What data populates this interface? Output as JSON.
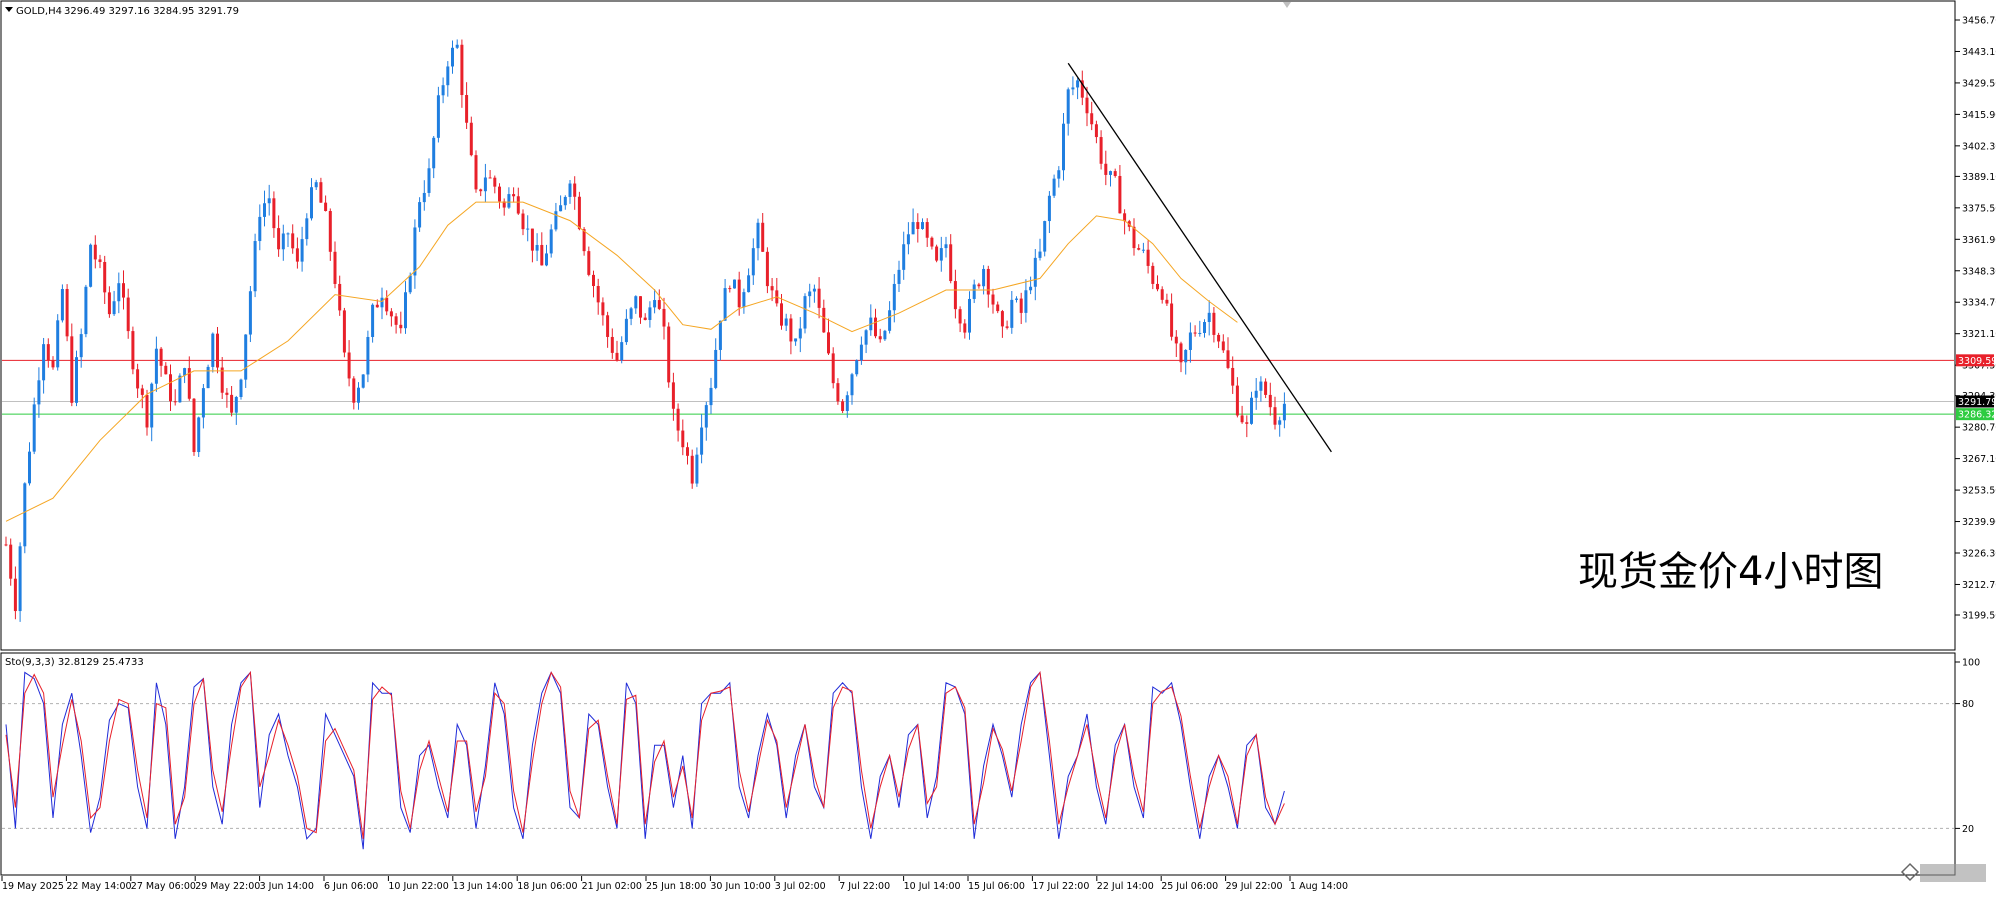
{
  "header": {
    "symbol": "GOLD,H4",
    "ohlc": "3296.49 3297.16 3284.95 3291.79"
  },
  "chart_title_overlay": "现货金价4小时图",
  "chart_data": [
    {
      "type": "candlestick",
      "symbol": "GOLD",
      "timeframe": "H4",
      "ylim": [
        3199.5,
        3456.7
      ],
      "price_axis_ticks": [
        "3456.70",
        "3443.10",
        "3429.50",
        "3415.90",
        "3402.30",
        "3389.10",
        "3375.50",
        "3361.90",
        "3348.30",
        "3334.70",
        "3321.10",
        "3307.50",
        "3294.30",
        "3280.70",
        "3267.10",
        "3253.50",
        "3239.90",
        "3226.30",
        "3212.70",
        "3199.50"
      ],
      "time_axis_ticks": [
        "19 May 2025",
        "22 May 14:00",
        "27 May 06:00",
        "29 May 22:00",
        "3 Jun 14:00",
        "6 Jun 06:00",
        "10 Jun 22:00",
        "13 Jun 14:00",
        "18 Jun 06:00",
        "21 Jun 02:00",
        "25 Jun 18:00",
        "30 Jun 10:00",
        "3 Jul 02:00",
        "7 Jul 22:00",
        "10 Jul 14:00",
        "15 Jul 06:00",
        "17 Jul 22:00",
        "22 Jul 14:00",
        "25 Jul 06:00",
        "29 Jul 22:00",
        "1 Aug 14:00"
      ],
      "horizontal_lines": [
        {
          "price": 3309.59,
          "label": "3309.59",
          "color": "#e8202a"
        },
        {
          "price": 3291.79,
          "label": "3291.79",
          "color": "#c0c0c0"
        },
        {
          "price": 3286.32,
          "label": "3286.32",
          "color": "#2ecc40"
        }
      ],
      "price_path": [
        [
          0,
          3230
        ],
        [
          2,
          3205
        ],
        [
          4,
          3255
        ],
        [
          6,
          3290
        ],
        [
          8,
          3320
        ],
        [
          10,
          3305
        ],
        [
          12,
          3340
        ],
        [
          14,
          3295
        ],
        [
          16,
          3320
        ],
        [
          18,
          3360
        ],
        [
          20,
          3348
        ],
        [
          22,
          3330
        ],
        [
          24,
          3345
        ],
        [
          26,
          3320
        ],
        [
          28,
          3300
        ],
        [
          30,
          3285
        ],
        [
          32,
          3315
        ],
        [
          34,
          3300
        ],
        [
          36,
          3290
        ],
        [
          38,
          3310
        ],
        [
          40,
          3270
        ],
        [
          42,
          3300
        ],
        [
          44,
          3320
        ],
        [
          46,
          3300
        ],
        [
          48,
          3285
        ],
        [
          50,
          3305
        ],
        [
          52,
          3340
        ],
        [
          54,
          3375
        ],
        [
          56,
          3380
        ],
        [
          58,
          3355
        ],
        [
          60,
          3365
        ],
        [
          62,
          3350
        ],
        [
          64,
          3375
        ],
        [
          66,
          3385
        ],
        [
          68,
          3370
        ],
        [
          70,
          3345
        ],
        [
          72,
          3310
        ],
        [
          74,
          3295
        ],
        [
          76,
          3305
        ],
        [
          78,
          3330
        ],
        [
          80,
          3340
        ],
        [
          82,
          3330
        ],
        [
          84,
          3320
        ],
        [
          86,
          3350
        ],
        [
          88,
          3380
        ],
        [
          90,
          3390
        ],
        [
          92,
          3420
        ],
        [
          94,
          3440
        ],
        [
          96,
          3445
        ],
        [
          98,
          3410
        ],
        [
          100,
          3380
        ],
        [
          102,
          3390
        ],
        [
          104,
          3385
        ],
        [
          106,
          3375
        ],
        [
          108,
          3385
        ],
        [
          110,
          3370
        ],
        [
          112,
          3360
        ],
        [
          114,
          3350
        ],
        [
          116,
          3365
        ],
        [
          118,
          3375
        ],
        [
          120,
          3390
        ],
        [
          122,
          3370
        ],
        [
          124,
          3350
        ],
        [
          126,
          3335
        ],
        [
          128,
          3320
        ],
        [
          130,
          3310
        ],
        [
          132,
          3325
        ],
        [
          134,
          3335
        ],
        [
          136,
          3325
        ],
        [
          138,
          3340
        ],
        [
          140,
          3320
        ],
        [
          142,
          3285
        ],
        [
          144,
          3275
        ],
        [
          146,
          3260
        ],
        [
          148,
          3285
        ],
        [
          150,
          3300
        ],
        [
          152,
          3330
        ],
        [
          154,
          3345
        ],
        [
          156,
          3335
        ],
        [
          158,
          3350
        ],
        [
          160,
          3365
        ],
        [
          162,
          3345
        ],
        [
          164,
          3330
        ],
        [
          166,
          3325
        ],
        [
          168,
          3315
        ],
        [
          170,
          3335
        ],
        [
          172,
          3340
        ],
        [
          174,
          3320
        ],
        [
          176,
          3300
        ],
        [
          178,
          3290
        ],
        [
          180,
          3305
        ],
        [
          182,
          3320
        ],
        [
          184,
          3325
        ],
        [
          186,
          3315
        ],
        [
          188,
          3330
        ],
        [
          190,
          3350
        ],
        [
          192,
          3365
        ],
        [
          194,
          3370
        ],
        [
          196,
          3360
        ],
        [
          198,
          3350
        ],
        [
          200,
          3360
        ],
        [
          202,
          3335
        ],
        [
          204,
          3325
        ],
        [
          206,
          3340
        ],
        [
          208,
          3350
        ],
        [
          210,
          3335
        ],
        [
          212,
          3320
        ],
        [
          214,
          3335
        ],
        [
          216,
          3330
        ],
        [
          218,
          3345
        ],
        [
          220,
          3355
        ],
        [
          222,
          3380
        ],
        [
          224,
          3395
        ],
        [
          226,
          3425
        ],
        [
          228,
          3430
        ],
        [
          230,
          3420
        ],
        [
          232,
          3405
        ],
        [
          234,
          3390
        ],
        [
          236,
          3385
        ],
        [
          238,
          3370
        ],
        [
          240,
          3360
        ],
        [
          242,
          3355
        ],
        [
          244,
          3345
        ],
        [
          246,
          3340
        ],
        [
          248,
          3320
        ],
        [
          250,
          3305
        ],
        [
          252,
          3320
        ],
        [
          254,
          3325
        ],
        [
          256,
          3330
        ],
        [
          258,
          3320
        ],
        [
          260,
          3305
        ],
        [
          262,
          3290
        ],
        [
          264,
          3280
        ],
        [
          266,
          3300
        ],
        [
          268,
          3295
        ],
        [
          270,
          3285
        ],
        [
          272,
          3291
        ]
      ],
      "ma_path": [
        [
          0,
          3240
        ],
        [
          10,
          3250
        ],
        [
          20,
          3275
        ],
        [
          30,
          3295
        ],
        [
          40,
          3305
        ],
        [
          50,
          3305
        ],
        [
          60,
          3318
        ],
        [
          70,
          3338
        ],
        [
          80,
          3335
        ],
        [
          88,
          3350
        ],
        [
          94,
          3368
        ],
        [
          100,
          3378
        ],
        [
          110,
          3378
        ],
        [
          120,
          3370
        ],
        [
          130,
          3355
        ],
        [
          138,
          3340
        ],
        [
          144,
          3325
        ],
        [
          150,
          3323
        ],
        [
          156,
          3332
        ],
        [
          164,
          3337
        ],
        [
          172,
          3330
        ],
        [
          180,
          3322
        ],
        [
          190,
          3330
        ],
        [
          200,
          3340
        ],
        [
          210,
          3340
        ],
        [
          220,
          3345
        ],
        [
          226,
          3360
        ],
        [
          232,
          3372
        ],
        [
          238,
          3370
        ],
        [
          244,
          3360
        ],
        [
          250,
          3345
        ],
        [
          256,
          3335
        ],
        [
          262,
          3326
        ]
      ],
      "trendline": {
        "from": [
          226,
          3438
        ],
        "to": [
          282,
          3270
        ],
        "color": "#000000"
      }
    },
    {
      "type": "line",
      "indicator": "Sto(9,3,3)",
      "header": "Sto(9,3,3) 32.8129 25.4733",
      "ylim": [
        0,
        100
      ],
      "axis_ticks": [
        "100",
        "80",
        "20"
      ],
      "levels": [
        80,
        20
      ],
      "series": [
        {
          "color": "#1f2bd8",
          "values": [
            70,
            20,
            95,
            92,
            80,
            25,
            70,
            85,
            55,
            18,
            35,
            72,
            80,
            78,
            40,
            20,
            90,
            70,
            15,
            40,
            88,
            92,
            40,
            22,
            70,
            90,
            95,
            30,
            65,
            75,
            55,
            40,
            15,
            20,
            75,
            65,
            55,
            45,
            10,
            90,
            85,
            85,
            30,
            18,
            55,
            60,
            40,
            25,
            70,
            60,
            20,
            50,
            90,
            75,
            30,
            15,
            60,
            85,
            95,
            85,
            30,
            25,
            75,
            70,
            40,
            20,
            90,
            80,
            15,
            60,
            60,
            30,
            55,
            20,
            80,
            85,
            85,
            90,
            40,
            25,
            55,
            75,
            60,
            25,
            55,
            70,
            40,
            30,
            85,
            90,
            85,
            40,
            15,
            45,
            55,
            30,
            65,
            70,
            25,
            45,
            90,
            88,
            75,
            15,
            50,
            70,
            55,
            35,
            70,
            90,
            95,
            55,
            15,
            45,
            55,
            75,
            40,
            22,
            60,
            70,
            40,
            25,
            88,
            85,
            90,
            70,
            40,
            15,
            45,
            55,
            40,
            20,
            60,
            65,
            30,
            22,
            38
          ]
        },
        {
          "color": "#e8202a",
          "values": [
            65,
            30,
            85,
            94,
            85,
            35,
            60,
            82,
            62,
            25,
            30,
            62,
            82,
            80,
            48,
            25,
            80,
            78,
            22,
            35,
            80,
            92,
            48,
            28,
            60,
            88,
            95,
            40,
            55,
            72,
            60,
            45,
            20,
            18,
            62,
            68,
            58,
            48,
            15,
            82,
            88,
            84,
            38,
            20,
            48,
            62,
            45,
            28,
            62,
            62,
            28,
            45,
            85,
            80,
            38,
            18,
            52,
            80,
            95,
            88,
            38,
            25,
            68,
            72,
            45,
            22,
            82,
            84,
            22,
            52,
            62,
            35,
            50,
            25,
            72,
            85,
            86,
            88,
            48,
            28,
            50,
            72,
            62,
            30,
            50,
            70,
            45,
            30,
            78,
            88,
            86,
            48,
            20,
            40,
            55,
            35,
            58,
            70,
            32,
            40,
            85,
            88,
            78,
            22,
            42,
            68,
            58,
            38,
            62,
            88,
            95,
            62,
            22,
            40,
            55,
            70,
            45,
            25,
            55,
            70,
            45,
            28,
            80,
            86,
            88,
            74,
            45,
            20,
            40,
            55,
            45,
            22,
            55,
            65,
            35,
            22,
            32
          ]
        }
      ]
    }
  ]
}
